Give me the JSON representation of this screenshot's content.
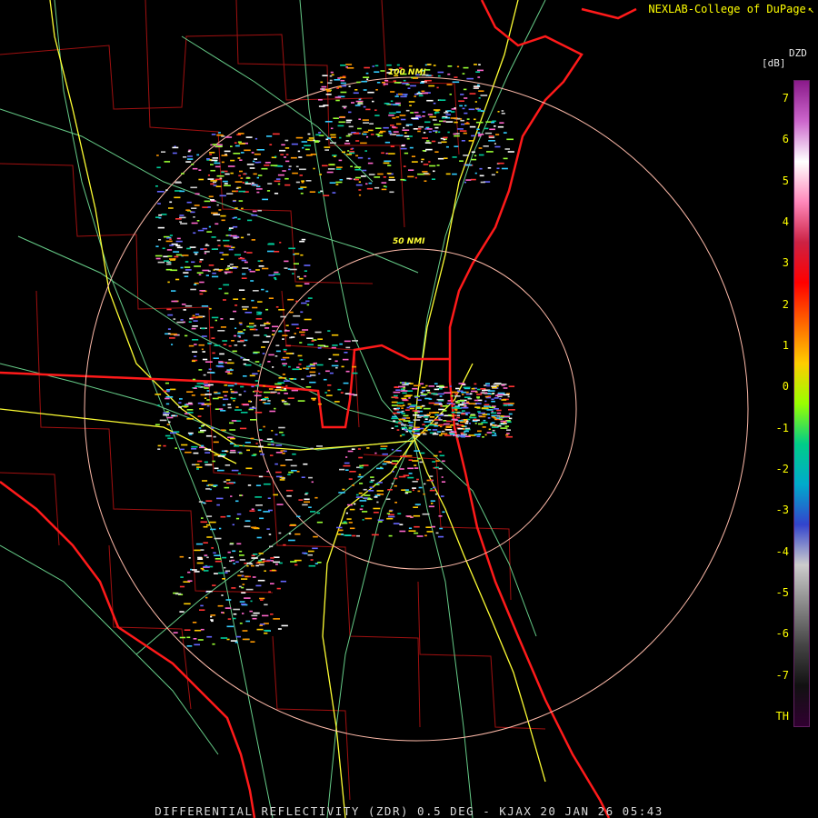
{
  "credit": "NEXLAB-College of DuPage",
  "credit_mark": "↖",
  "legend": {
    "title": "DZD",
    "unit": "[dB]",
    "ticks": [
      "7",
      "6",
      "5",
      "4",
      "3",
      "2",
      "1",
      "0",
      "-1",
      "-2",
      "-3",
      "-4",
      "-5",
      "-6",
      "-7",
      "TH"
    ],
    "colors": [
      "#8a1a8a",
      "#cc66cc",
      "#ffffff",
      "#ff88bb",
      "#cc2244",
      "#ff0000",
      "#ff6600",
      "#ffcc00",
      "#99ff00",
      "#00cc88",
      "#00aacc",
      "#3344cc",
      "#cccccc",
      "#888888",
      "#444444",
      "#111111",
      "#300030"
    ]
  },
  "range_rings": {
    "inner": "50 NMI",
    "outer": "100 NMI"
  },
  "footer": "DIFFERENTIAL REFLECTIVITY (ZDR) 0.5 DEG - KJAX 20 JAN 26 05:43",
  "map_colors": {
    "coast": "#ff1a1a",
    "county": "#a01010",
    "roads": "#66cc88",
    "interstate": "#ffff33",
    "ring": "#ffbbaa"
  }
}
